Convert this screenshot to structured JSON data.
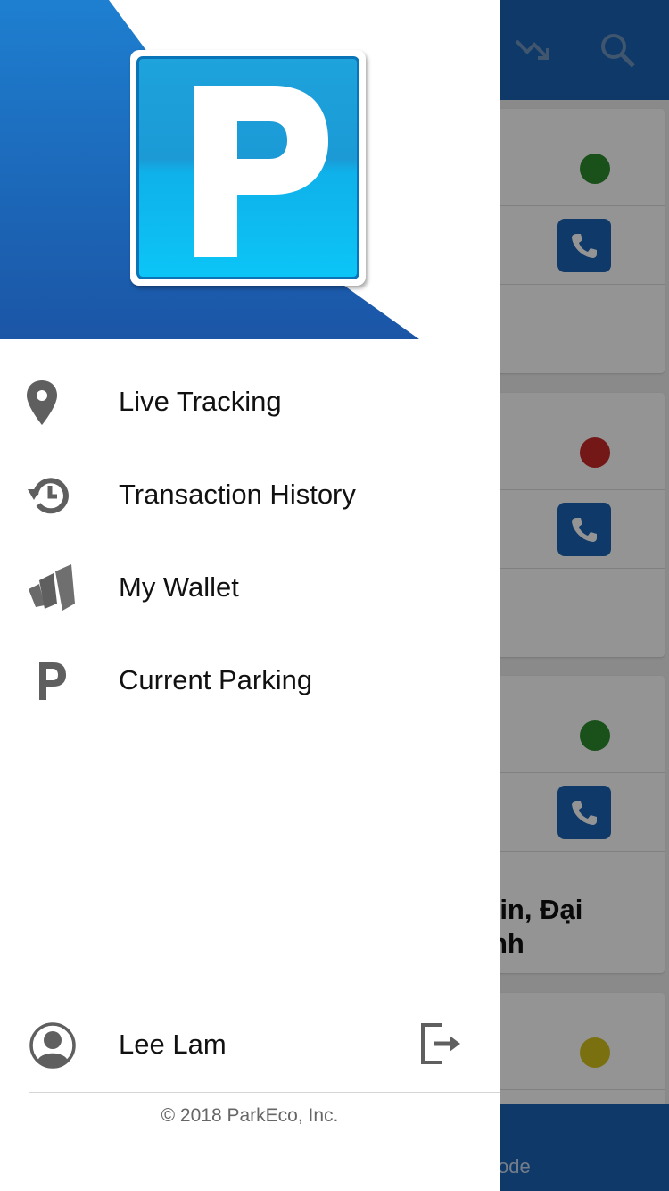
{
  "background_app": {
    "address_partial": "tin, Đại",
    "address_partial_2": "nh",
    "bottom_tab_partial": "ode",
    "status_colors": [
      "#2e8b2e",
      "#c62828",
      "#2e8b2e",
      "#d4c21a"
    ]
  },
  "drawer": {
    "menu": [
      {
        "label": "Live Tracking",
        "icon": "location-pin-icon"
      },
      {
        "label": "Transaction History",
        "icon": "history-icon"
      },
      {
        "label": "My Wallet",
        "icon": "wallet-logo-icon"
      },
      {
        "label": "Current Parking",
        "icon": "parking-p-icon"
      }
    ],
    "user": {
      "name": "Lee Lam",
      "icon": "user-avatar-icon",
      "logout_icon": "logout-icon"
    },
    "copyright": "© 2018 ParkEco, Inc."
  },
  "colors": {
    "brand_blue": "#1b63b3",
    "logo_cyan": "#0cc5f7",
    "icon_gray": "#5f5f5f"
  }
}
